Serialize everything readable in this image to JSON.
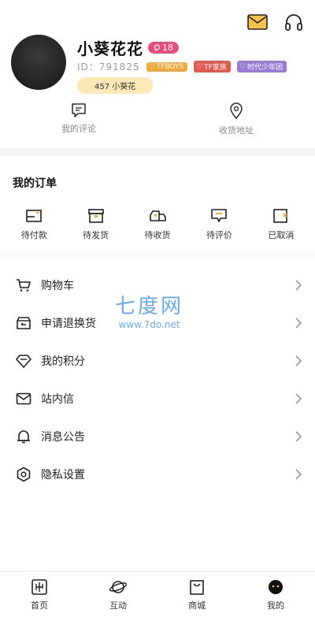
{
  "header": {
    "icons": [
      "mail-icon",
      "headset-icon"
    ]
  },
  "profile": {
    "name": "小葵花花",
    "level": "18",
    "id_text": "ID：791825",
    "tags": [
      "TFBOYS",
      "TF家族",
      "时代少年团"
    ],
    "fans_label": "457 小葵花"
  },
  "quick_links": [
    {
      "label": "我的评论",
      "icon": "comment-icon"
    },
    {
      "label": "收货地址",
      "icon": "location-pin-icon"
    }
  ],
  "orders": {
    "title": "我的订单",
    "items": [
      {
        "label": "待付款",
        "icon": "wallet-icon"
      },
      {
        "label": "待发货",
        "icon": "box-icon"
      },
      {
        "label": "待收货",
        "icon": "truck-icon"
      },
      {
        "label": "待评价",
        "icon": "review-icon"
      },
      {
        "label": "已取消",
        "icon": "cancelled-icon"
      }
    ]
  },
  "menu": [
    {
      "label": "购物车",
      "icon": "cart-icon"
    },
    {
      "label": "申请退换货",
      "icon": "return-icon"
    },
    {
      "label": "我的积分",
      "icon": "diamond-icon"
    },
    {
      "label": "站内信",
      "icon": "mail-icon"
    },
    {
      "label": "消息公告",
      "icon": "bell-icon"
    },
    {
      "label": "隐私设置",
      "icon": "settings-icon"
    }
  ],
  "watermark": {
    "big": "七度网",
    "small": "www.7do.net"
  },
  "tabbar": [
    {
      "label": "首页",
      "icon": "home-icon"
    },
    {
      "label": "互动",
      "icon": "planet-icon"
    },
    {
      "label": "商城",
      "icon": "shopping-bag-icon"
    },
    {
      "label": "我的",
      "icon": "profile-icon"
    }
  ],
  "colors": {
    "accent_pink": "#e94c7f",
    "tag_orange": "#f2a93b",
    "tag_red": "#e05a4f",
    "tag_purple": "#9a7ad6",
    "fans_bg": "#fde9b5",
    "watermark_blue": "#4f9bea"
  }
}
